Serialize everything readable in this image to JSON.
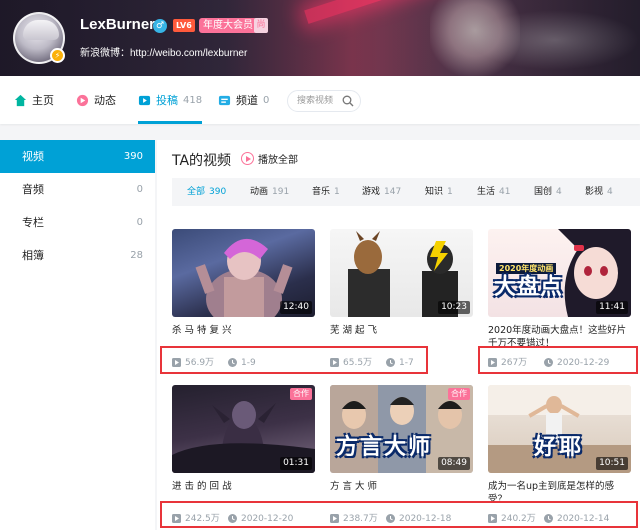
{
  "profile": {
    "name": "LexBurner",
    "level": "LV6",
    "vip": "年度大会员",
    "vip_extra": "尚",
    "weibo": "新浪微博：http://weibo.com/lexburner"
  },
  "nav": {
    "home": "主页",
    "dynamic": "动态",
    "posts": "投稿",
    "posts_count": "418",
    "channel": "频道",
    "channel_count": "0",
    "search_placeholder": "搜索视频"
  },
  "sidebar": {
    "items": [
      {
        "label": "视频",
        "count": "390"
      },
      {
        "label": "音频",
        "count": "0"
      },
      {
        "label": "专栏",
        "count": "0"
      },
      {
        "label": "相簿",
        "count": "28"
      }
    ]
  },
  "main": {
    "title": "TA的视频",
    "play_all": "播放全部",
    "filters": [
      {
        "label": "全部",
        "count": "390"
      },
      {
        "label": "动画",
        "count": "191"
      },
      {
        "label": "音乐",
        "count": "1"
      },
      {
        "label": "游戏",
        "count": "147"
      },
      {
        "label": "知识",
        "count": "1"
      },
      {
        "label": "生活",
        "count": "41"
      },
      {
        "label": "国创",
        "count": "4"
      },
      {
        "label": "影视",
        "count": "4"
      }
    ],
    "videos": [
      {
        "title": "杀 马 特 复 兴",
        "duration": "12:40",
        "plays": "56.9万",
        "date": "1-9",
        "tag": ""
      },
      {
        "title": "芜 湖 起 飞",
        "duration": "10:23",
        "plays": "65.5万",
        "date": "1-7",
        "tag": ""
      },
      {
        "title": "2020年度动画大盘点！这些好片千万不要错过！",
        "duration": "11:41",
        "plays": "267万",
        "date": "2020-12-29",
        "tag": "",
        "overlay_top": "2020年度动画",
        "overlay_main": "大盘点"
      },
      {
        "title": "进 击 的 回 战",
        "duration": "01:31",
        "plays": "242.5万",
        "date": "2020-12-20",
        "tag": "合作"
      },
      {
        "title": "方 言 大 师",
        "duration": "08:49",
        "plays": "238.7万",
        "date": "2020-12-18",
        "tag": "合作",
        "overlay_main": "方言大师"
      },
      {
        "title": "成为一名up主到底是怎样的感受？",
        "duration": "10:51",
        "plays": "240.2万",
        "date": "2020-12-14",
        "tag": "",
        "overlay_main": "好耶"
      }
    ]
  },
  "colors": {
    "accent": "#00a1d6",
    "pink": "#fb7299",
    "highlight": "#e8343a"
  }
}
